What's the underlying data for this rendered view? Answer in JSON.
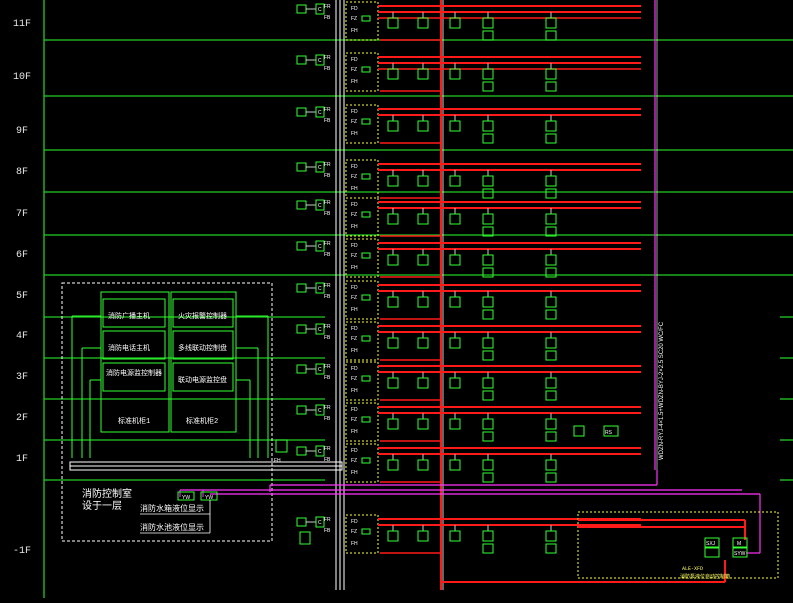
{
  "floors": [
    "11F",
    "10F",
    "9F",
    "8F",
    "7F",
    "6F",
    "5F",
    "4F",
    "3F",
    "2F",
    "1F",
    "-1F"
  ],
  "module_labels": {
    "fd": "FD",
    "fz": "FZ",
    "fh": "FH",
    "fr": "FR",
    "fb": "FB",
    "c": "C"
  },
  "control_room": {
    "title_line1": "消防控制室",
    "title_line2": "设于一层",
    "cabinet1_label": "标准机柜1",
    "cabinet2_label": "标准机柜2",
    "cabinet1_items": [
      "消防广播主机",
      "消防电话主机",
      "消防电源监控制器"
    ],
    "cabinet2_items": [
      "火灾报警控制器",
      "多线联动控制盘",
      "联动电源监控盘"
    ],
    "tank_level_1": "消防水箱液位显示",
    "tank_level_2": "消防水池液位显示",
    "yw_label": "YW",
    "fh_tag": "FH"
  },
  "panel_bottom_right": {
    "ap_tag": "ALE-XFD",
    "desc": "消防泵液位自动控制箱",
    "tag1": "SXJ",
    "tag2": "M",
    "tag3": "SYW"
  },
  "vertical_riser_label": "WDZN-RYJ-4×1.5+WDZN-BYJ-2×2.5 SC20 WC/FC",
  "bus_label_2f": "RS",
  "colors": {
    "grid": "#22cc22",
    "red": "#ff1a1a",
    "magenta": "#ff33ff",
    "white": "#ffffff",
    "green": "#33ff33",
    "yellow": "#ffff33"
  }
}
